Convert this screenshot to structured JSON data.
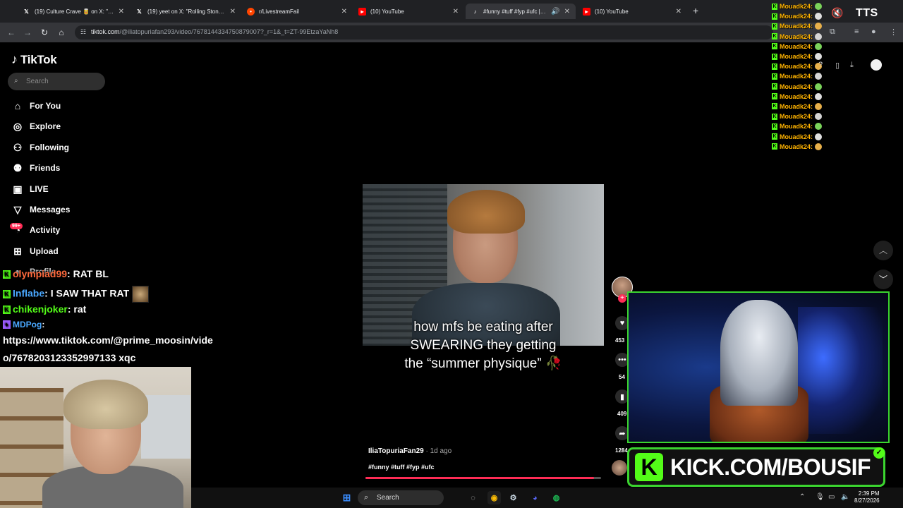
{
  "browser": {
    "tabs": [
      {
        "title": "(19) Culture Crave 🥫 on X: \"Ro",
        "icon": "x-icon",
        "active": false
      },
      {
        "title": "(19) yeet on X: \"Rolling Stone d",
        "icon": "x-icon",
        "active": false
      },
      {
        "title": "r/LivestreamFail",
        "icon": "reddit-icon",
        "active": false
      },
      {
        "title": "(10) YouTube",
        "icon": "youtube-icon",
        "active": false
      },
      {
        "title": "#funny #tuff #fyp #ufc | ca",
        "icon": "tiktok-icon",
        "active": true
      },
      {
        "title": "(10) YouTube",
        "icon": "youtube-icon",
        "active": false
      }
    ],
    "url_main": "tiktok.com",
    "url_rest": "/@iliatopuriafan293/video/7678144334750879007?_r=1&_t=ZT-99EtzaYaNh8"
  },
  "tiktok": {
    "logo": "TikTok",
    "search_placeholder": "Search",
    "nav": [
      {
        "label": "For You",
        "icon": "home-icon"
      },
      {
        "label": "Explore",
        "icon": "compass-icon"
      },
      {
        "label": "Following",
        "icon": "following-icon"
      },
      {
        "label": "Friends",
        "icon": "friends-icon"
      },
      {
        "label": "LIVE",
        "icon": "live-icon"
      },
      {
        "label": "Messages",
        "icon": "messages-icon"
      },
      {
        "label": "Activity",
        "icon": "activity-icon"
      },
      {
        "label": "Upload",
        "icon": "upload-icon"
      },
      {
        "label": "Profile",
        "icon": "profile-icon"
      }
    ],
    "activity_badge": "99+",
    "video": {
      "caption_lines": [
        "how mfs be eating after",
        "SWEARING they getting",
        "the “summer physique” 🥀"
      ],
      "author": "IliaTopuriaFan29",
      "posted": "· 1d ago",
      "tags": "#funny #tuff #fyp #ufc",
      "progress": 0.97
    },
    "counts": {
      "likes": "453",
      "comments": "54",
      "saves": "409",
      "shares": "1284"
    }
  },
  "chat": [
    {
      "user": "olympiad99",
      "text": "RAT BL",
      "color": "u1"
    },
    {
      "user": "Inflabe",
      "text": "I SAW THAT RAT",
      "color": "u2"
    },
    {
      "user": "chikenjoker",
      "text": "rat",
      "color": "u3"
    },
    {
      "user": "MDPog",
      "text": "",
      "color": "u2"
    },
    {
      "user": "",
      "text": "https://www.tiktok.com/@prime_moosin/vide",
      "color": ""
    },
    {
      "user": "",
      "text": "o/7678203123352997133 xqc",
      "color": ""
    }
  ],
  "side_chat": {
    "name": "Mouadk24:",
    "rows": 15
  },
  "overlay": {
    "tts": "TTS",
    "kick_text": "KICK.COM/BOUSIF",
    "kick_logo": "K"
  },
  "taskbar": {
    "search": "Search",
    "time": "2:39 PM",
    "date": "8/27/2026"
  }
}
